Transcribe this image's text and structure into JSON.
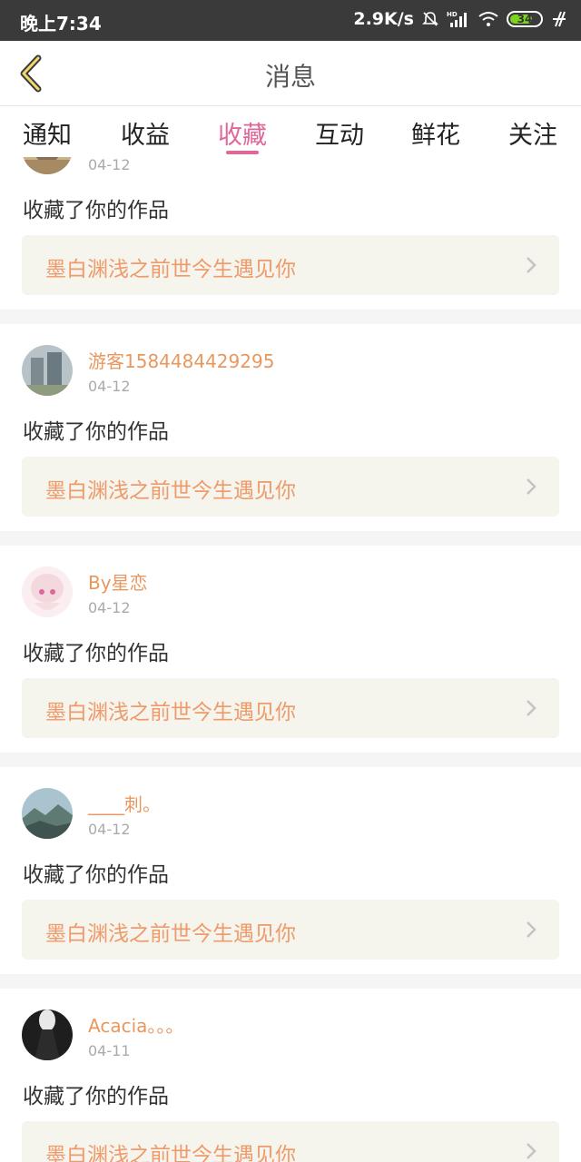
{
  "status_bar": {
    "time": "晚上7:34",
    "network_speed": "2.9K/s",
    "hd_label": "HD",
    "battery": "34"
  },
  "header": {
    "title": "消息"
  },
  "tabs": [
    {
      "label": "通知"
    },
    {
      "label": "收益"
    },
    {
      "label": "收藏",
      "active": true
    },
    {
      "label": "互动"
    },
    {
      "label": "鲜花"
    },
    {
      "label": "关注"
    }
  ],
  "notifications": [
    {
      "username": "",
      "date": "04-12",
      "action": "收藏了你的作品",
      "work_title": "墨白渊浅之前世今生遇见你",
      "avatar": "anime-avatar-icon"
    },
    {
      "username": "游客1584484429295",
      "date": "04-12",
      "action": "收藏了你的作品",
      "work_title": "墨白渊浅之前世今生遇见你",
      "avatar": "building-avatar-icon"
    },
    {
      "username": "By星恋",
      "date": "04-12",
      "action": "收藏了你的作品",
      "work_title": "墨白渊浅之前世今生遇见你",
      "avatar": "anime-girl-avatar-icon"
    },
    {
      "username": "____刺。",
      "date": "04-12",
      "action": "收藏了你的作品",
      "work_title": "墨白渊浅之前世今生遇见你",
      "avatar": "mountain-avatar-icon"
    },
    {
      "username": "Acacia。。。",
      "date": "04-11",
      "action": "收藏了你的作品",
      "work_title": "墨白渊浅之前世今生遇见你",
      "avatar": "dark-avatar-icon"
    }
  ],
  "colors": {
    "accent": "#e0679a",
    "username": "#e8985e",
    "work_title": "#ef9a6a",
    "link_bg": "#f5f5ee"
  }
}
